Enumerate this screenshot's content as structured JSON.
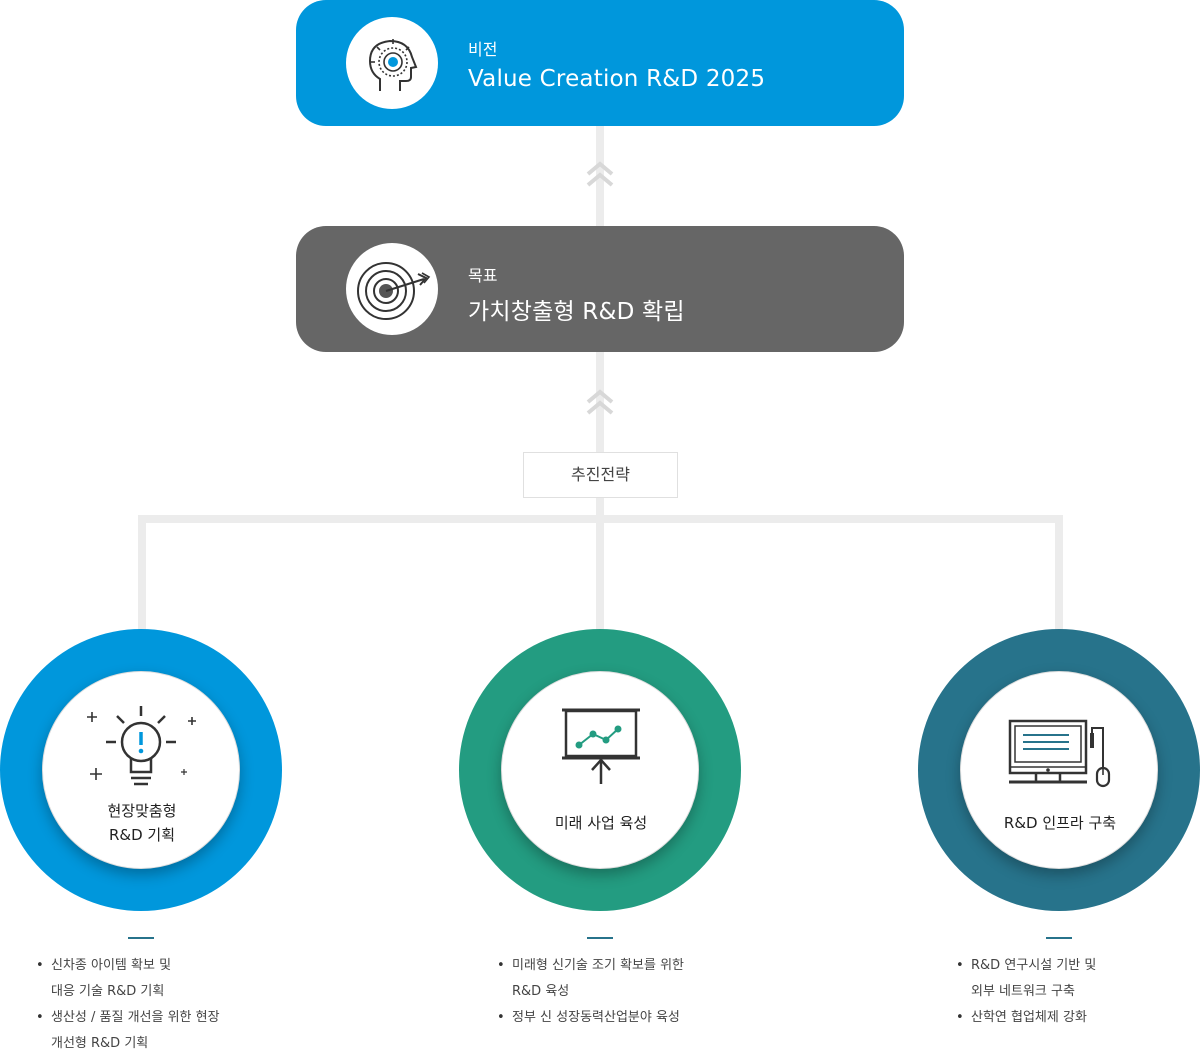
{
  "vision": {
    "kicker": "비전",
    "title": "Value Creation R&D 2025",
    "icon": "head-target-icon",
    "color": "#0097dc"
  },
  "goal": {
    "kicker": "목표",
    "title": "가치창출형 R&D 확립",
    "icon": "bullseye-arrow-icon",
    "color": "#666666"
  },
  "strategy_label": "추진전략",
  "strategies": [
    {
      "label_line1": "현장맞춤형",
      "label_line2": "R&D 기획",
      "icon": "lightbulb-icon",
      "color": "#0097dc",
      "bullets": [
        "신차종 아이템 확보 및\n대응 기술 R&D 기획",
        "생산성 / 품질 개선을 위한 현장\n개선형 R&D 기획"
      ]
    },
    {
      "label_line1": "미래 사업 육성",
      "icon": "presentation-chart-icon",
      "color": "#239c81",
      "bullets": [
        "미래형 신기술 조기 확보를 위한\nR&D 육성",
        "정부 신 성장동력산업분야 육성"
      ]
    },
    {
      "label_line1": "R&D 인프라 구축",
      "icon": "computer-icon",
      "color": "#27738b",
      "bullets": [
        "R&D 연구시설 기반 및\n외부 네트워크 구축",
        "산학연 협업체제 강화"
      ]
    }
  ]
}
